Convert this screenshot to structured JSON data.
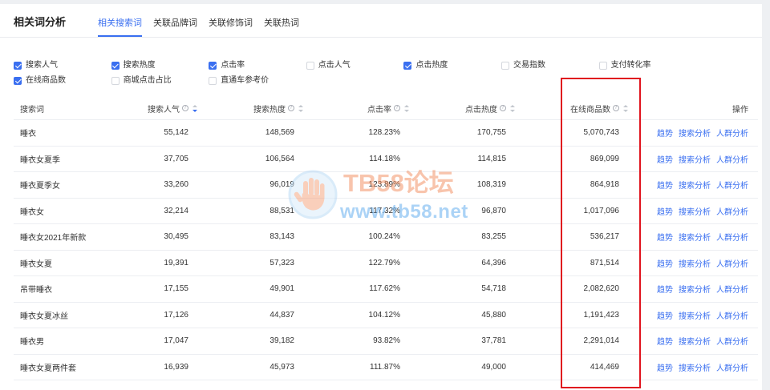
{
  "header": {
    "title": "相关词分析",
    "tabs": [
      {
        "label": "相关搜索词",
        "active": true
      },
      {
        "label": "关联品牌词",
        "active": false
      },
      {
        "label": "关联修饰词",
        "active": false
      },
      {
        "label": "关联热词",
        "active": false
      }
    ]
  },
  "metric_filters": [
    {
      "label": "搜索人气",
      "checked": true
    },
    {
      "label": "搜索热度",
      "checked": true
    },
    {
      "label": "点击率",
      "checked": true
    },
    {
      "label": "点击人气",
      "checked": false
    },
    {
      "label": "点击热度",
      "checked": true
    },
    {
      "label": "交易指数",
      "checked": false
    },
    {
      "label": "支付转化率",
      "checked": false
    },
    {
      "label": "在线商品数",
      "checked": true
    },
    {
      "label": "商城点击占比",
      "checked": false
    },
    {
      "label": "直通车参考价",
      "checked": false
    }
  ],
  "table": {
    "columns": {
      "term": {
        "label": "搜索词"
      },
      "search_popularity": {
        "label": "搜索人气",
        "sortable": true,
        "sorted_desc": true
      },
      "search_heat": {
        "label": "搜索热度",
        "sortable": true,
        "sorted_desc": false
      },
      "click_rate": {
        "label": "点击率",
        "sortable": true,
        "sorted_desc": false
      },
      "click_heat": {
        "label": "点击热度",
        "sortable": true,
        "sorted_desc": false
      },
      "online_products": {
        "label": "在线商品数",
        "sortable": true,
        "sorted_desc": false,
        "highlighted": true
      },
      "actions": {
        "label": "操作"
      }
    },
    "action_labels": [
      "趋势",
      "搜索分析",
      "人群分析"
    ],
    "rows": [
      {
        "term": "睡衣",
        "search_popularity": "55,142",
        "search_heat": "148,569",
        "click_rate": "128.23%",
        "click_heat": "170,755",
        "online_products": "5,070,743"
      },
      {
        "term": "睡衣女夏季",
        "search_popularity": "37,705",
        "search_heat": "106,564",
        "click_rate": "114.18%",
        "click_heat": "114,815",
        "online_products": "869,099"
      },
      {
        "term": "睡衣夏季女",
        "search_popularity": "33,260",
        "search_heat": "96,019",
        "click_rate": "123.89%",
        "click_heat": "108,319",
        "online_products": "864,918"
      },
      {
        "term": "睡衣女",
        "search_popularity": "32,214",
        "search_heat": "88,531",
        "click_rate": "117.32%",
        "click_heat": "96,870",
        "online_products": "1,017,096"
      },
      {
        "term": "睡衣女2021年新款",
        "search_popularity": "30,495",
        "search_heat": "83,143",
        "click_rate": "100.24%",
        "click_heat": "83,255",
        "online_products": "536,217"
      },
      {
        "term": "睡衣女夏",
        "search_popularity": "19,391",
        "search_heat": "57,323",
        "click_rate": "122.79%",
        "click_heat": "64,396",
        "online_products": "871,514"
      },
      {
        "term": "吊带睡衣",
        "search_popularity": "17,155",
        "search_heat": "49,901",
        "click_rate": "117.62%",
        "click_heat": "54,718",
        "online_products": "2,082,620"
      },
      {
        "term": "睡衣女夏冰丝",
        "search_popularity": "17,126",
        "search_heat": "44,837",
        "click_rate": "104.12%",
        "click_heat": "45,880",
        "online_products": "1,191,423"
      },
      {
        "term": "睡衣男",
        "search_popularity": "17,047",
        "search_heat": "39,182",
        "click_rate": "93.82%",
        "click_heat": "37,781",
        "online_products": "2,291,014"
      },
      {
        "term": "睡衣女夏两件套",
        "search_popularity": "16,939",
        "search_heat": "45,973",
        "click_rate": "111.87%",
        "click_heat": "49,000",
        "online_products": "414,469"
      }
    ]
  },
  "watermark": {
    "title": "TB58论坛",
    "url": "www.tb58.net"
  },
  "icons": {
    "column_info": "info-icon",
    "column_sort": "sort-icon",
    "checkbox": "checkbox-icon",
    "watermark_logo": "hand-logo"
  },
  "colors": {
    "accent": "#3a6ff0",
    "text": "#333333",
    "highlight": "#e0141e"
  }
}
